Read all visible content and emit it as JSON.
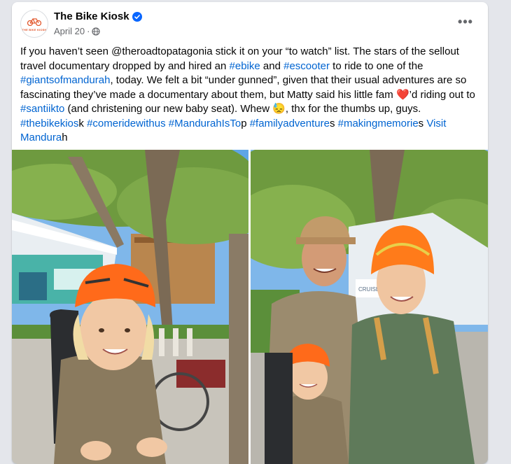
{
  "post": {
    "page_name": "The Bike Kiosk",
    "logo_text": "THE BIKE KIOSK",
    "date": "April 20",
    "more_label": "•••",
    "text": {
      "p1": "If you haven’t seen @theroadtopatagonia stick it on your “to watch” list. The stars of the sellout travel documentary dropped by and hired an ",
      "h_ebike": "#ebike",
      "p2": " and ",
      "h_escooter": "#escooter",
      "p3": " to ride to one of the ",
      "h_giants": "#giantsofmandurah",
      "p4": ", today.  We felt a bit “under gunned”, given that their usual adventures are so fascinating they’ve made a documentary about them, but Matty said his little fam ",
      "heart": "❤️",
      "p5": "’d riding out to ",
      "h_santiikto": "#santiikto",
      "p6": " (and christening our new baby seat). Whew ",
      "sweat": "😓",
      "p7": ", thx for the thumbs up, guys. ",
      "h_thebikekios": "#thebikekios",
      "p8": "k ",
      "h_comeride": "#comeridewithus",
      "p9": " ",
      "h_mandurah": "#MandurahIsTo",
      "p10": "p ",
      "h_family": "#familyadventure",
      "p11": "s ",
      "h_memories": "#makingmemorie",
      "p12": "s ",
      "h_visit": "Visit Mandura",
      "p13": "h"
    }
  },
  "photos": [
    {
      "name": "child-on-bike-seat-photo",
      "sign_text": ""
    },
    {
      "name": "family-portrait-photo",
      "sign_text": "CRUISES"
    }
  ],
  "colors": {
    "link": "#0064d1",
    "verified": "#0866ff",
    "helmet": "#ff6a1a",
    "sky": "#7fb7ea"
  }
}
